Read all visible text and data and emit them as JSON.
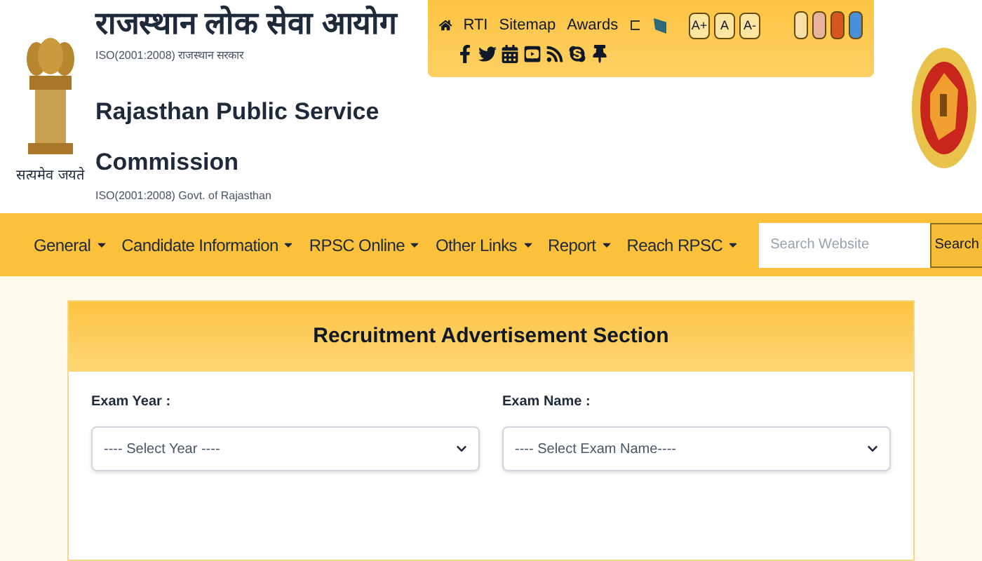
{
  "header": {
    "hindi_title": "राजस्थान लोक सेवा आयोग",
    "hindi_subtitle": "ISO(2001:2008) राजस्थान सरकार",
    "emblem_caption": "सत्यमेव जयते",
    "title": "Rajasthan Public Service Commission",
    "subtitle": "ISO(2001:2008) Govt. of Rajasthan"
  },
  "top_links": [
    "RTI",
    "Sitemap",
    "Awards"
  ],
  "font_sizes": [
    "A+",
    "A",
    "A-"
  ],
  "themes": [
    {
      "color": "#f6e0a8"
    },
    {
      "color": "#e6b39c"
    },
    {
      "color": "#d4571f"
    },
    {
      "color": "#4b8fd8"
    }
  ],
  "nav": {
    "items": [
      "General",
      "Candidate Information",
      "RPSC Online",
      "Other Links",
      "Report",
      "Reach RPSC"
    ],
    "search": {
      "placeholder": "Search Website"
    },
    "search_button": "Search"
  },
  "section": {
    "title": "Recruitment Advertisement Section",
    "fields": [
      {
        "label": "Exam Year :",
        "value": "---- Select Year ----"
      },
      {
        "label": "Exam Name :",
        "value": "---- Select Exam Name----"
      }
    ]
  }
}
